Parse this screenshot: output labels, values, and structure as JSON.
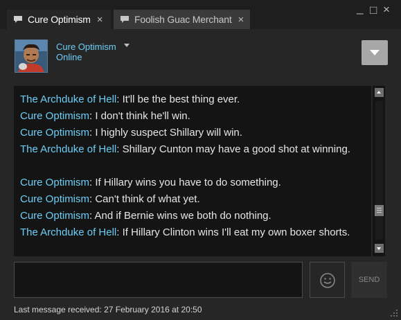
{
  "tabs": [
    {
      "label": "Cure Optimism",
      "close": "×"
    },
    {
      "label": "Foolish Guac Merchant",
      "close": "×"
    }
  ],
  "window_controls": {
    "minimize": "_",
    "maximize": "□",
    "close": "×"
  },
  "header": {
    "friend_name": "Cure Optimism",
    "status": "Online",
    "avatar_icon": "avatar-image",
    "menu_icon": "chevron-down-icon"
  },
  "messages": [
    {
      "sender": "The Archduke of Hell",
      "text": ": It'll be the best thing ever."
    },
    {
      "sender": "Cure Optimism",
      "text": ": I don't think he'll win."
    },
    {
      "sender": "Cure Optimism",
      "text": ": I highly suspect Shillary will win."
    },
    {
      "sender": "The Archduke of Hell",
      "text": ": Shillary Cunton may have a good shot at winning."
    },
    {
      "sender": "Cure Optimism",
      "text": ": If Hillary wins you have to do something."
    },
    {
      "sender": "Cure Optimism",
      "text": ": Can't think of what yet."
    },
    {
      "sender": "Cure Optimism",
      "text": ": And if Bernie wins we both do nothing."
    },
    {
      "sender": "The Archduke of Hell",
      "text": ": If Hillary Clinton wins I'll eat my own boxer shorts."
    }
  ],
  "composer": {
    "value": "",
    "send_label": "SEND",
    "emoticon_icon": "smiley-icon"
  },
  "footer": {
    "last_message": "Last message received: 27 February 2016 at 20:50"
  },
  "colors": {
    "sender": "#6dcff6",
    "background": "#262626",
    "log_background": "#141414"
  }
}
